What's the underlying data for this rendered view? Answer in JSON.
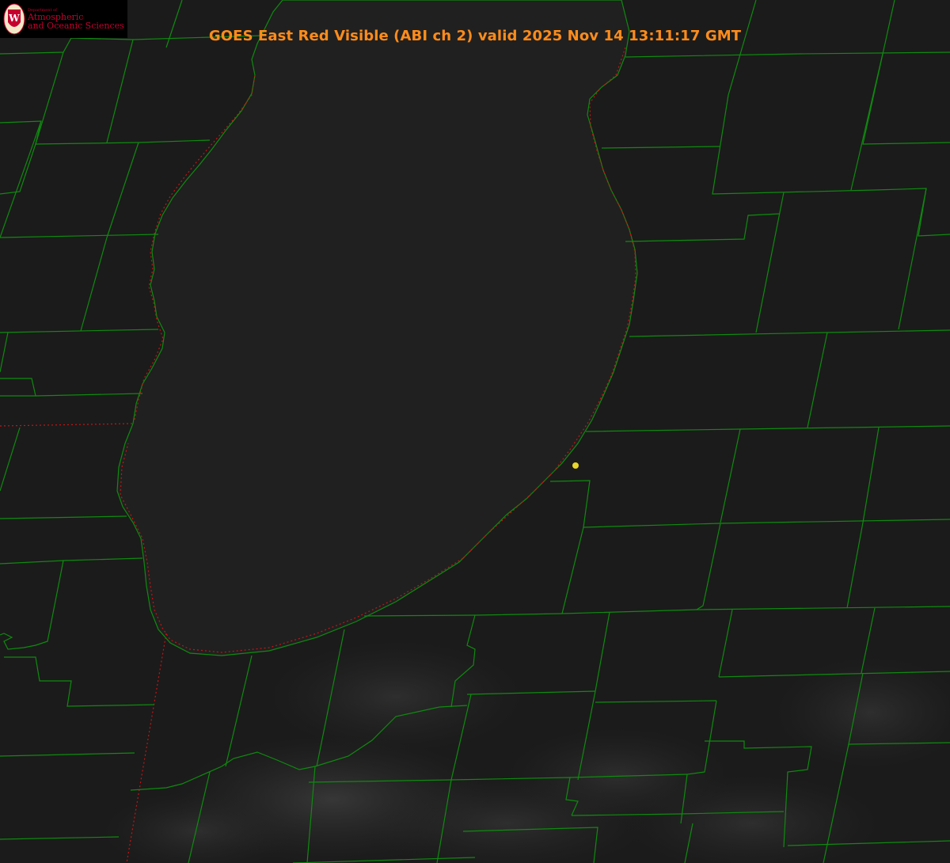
{
  "header": {
    "title": "GOES East Red Visible (ABI ch 2) valid 2025 Nov 14 13:11:17 GMT"
  },
  "logo": {
    "department": "Department of",
    "line1": "Atmospheric",
    "line2": "and Oceanic Sciences",
    "seal_letter": "W"
  },
  "colors": {
    "background": "#1b1b1b",
    "lake": "#202020",
    "county_lines": "#0f8a0f",
    "state_line": "#c81414",
    "title": "#ff8c1a",
    "station_marker": "#e8d52a",
    "logo_red": "#c5002f"
  },
  "map": {
    "product": "GOES East Red Visible",
    "features": [
      "lake-michigan-shoreline",
      "county-boundaries",
      "state-boundaries",
      "station-marker"
    ]
  }
}
